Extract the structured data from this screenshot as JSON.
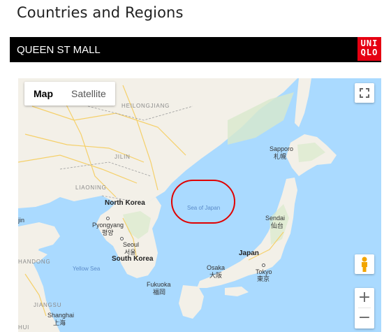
{
  "page": {
    "title": "Countries and Regions"
  },
  "store": {
    "name": "QUEEN ST MALL"
  },
  "logo": {
    "line1": "UNI",
    "line2": "QLO",
    "color": "#e60012"
  },
  "map": {
    "type_buttons": {
      "map": "Map",
      "satellite": "Satellite"
    },
    "labels": {
      "heilongjiang": "HEILONGJIANG",
      "jilin": "JILIN",
      "liaoning": "LIAONING",
      "north_korea": "North Korea",
      "pyongyang": "Pyongyang",
      "pyongyang_local": "평양",
      "seoul": "Seoul",
      "seoul_local": "서울",
      "south_korea": "South Korea",
      "sea_of_japan": "Sea of Japan",
      "sapporo": "Sapporo",
      "sapporo_local": "札幌",
      "sendai": "Sendai",
      "sendai_local": "仙台",
      "japan": "Japan",
      "osaka": "Osaka",
      "osaka_local": "大阪",
      "tokyo": "Tokyo",
      "tokyo_local": "東京",
      "fukuoka": "Fukuoka",
      "fukuoka_local": "福岡",
      "yellow_sea": "Yellow Sea",
      "jiangsu": "JIANGSU",
      "shanghai": "Shanghai",
      "shanghai_local": "上海",
      "tianjin": "jin",
      "shandong": "HANDONG",
      "hui": "HUI"
    },
    "zoom": {
      "in": "+",
      "out": "−"
    },
    "colors": {
      "land": "#f3f0e8",
      "water": "#aadaff",
      "highlight": "#e00000"
    }
  }
}
